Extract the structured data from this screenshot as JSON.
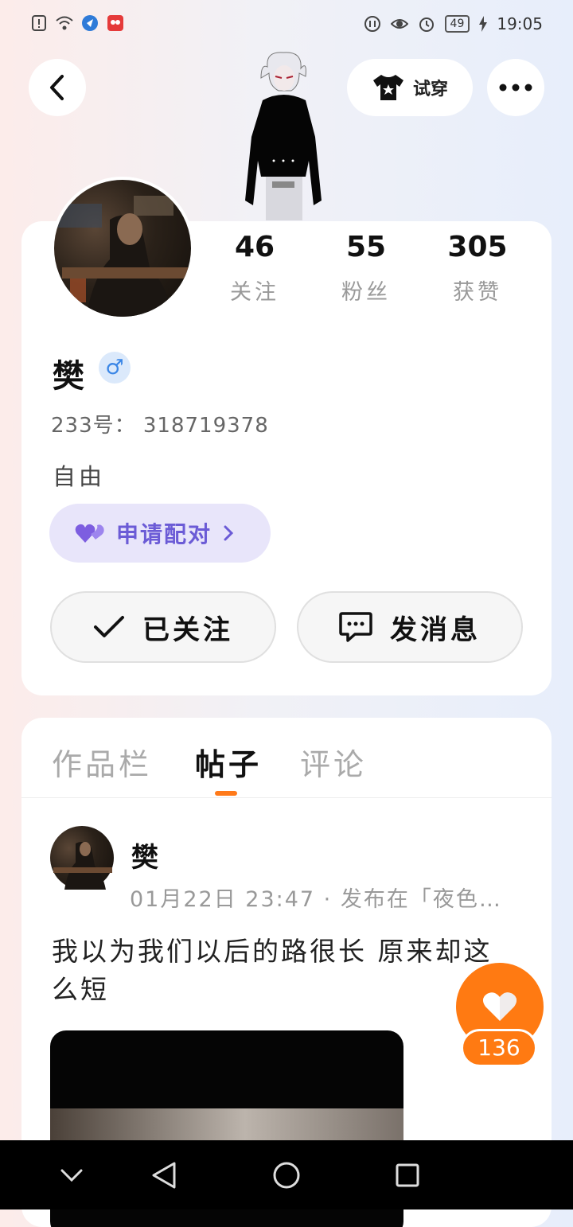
{
  "status_bar": {
    "time": "19:05",
    "battery": "49",
    "icons": [
      "alert-icon",
      "wifi-icon",
      "app-icon-blue",
      "app-icon-red",
      "nfc-icon",
      "eye-icon",
      "alarm-icon",
      "charging-icon"
    ]
  },
  "header": {
    "try_on_label": "试穿"
  },
  "profile": {
    "stats": [
      {
        "value": "46",
        "label": "关注"
      },
      {
        "value": "55",
        "label": "粉丝"
      },
      {
        "value": "305",
        "label": "获赞"
      }
    ],
    "name": "樊",
    "gender_symbol": "♂",
    "uid": "233号： 318719378",
    "bio": "自由",
    "pair_label": "申请配对",
    "follow_label": "已关注",
    "message_label": "发消息"
  },
  "tabs": [
    {
      "label": "作品栏",
      "active": false
    },
    {
      "label": "帖子",
      "active": true
    },
    {
      "label": "评论",
      "active": false
    }
  ],
  "post": {
    "author": "樊",
    "meta": "01月22日  23:47 · 发布在「夜色…",
    "text": "我以为我们以后的路很长 原来却这么短"
  },
  "like": {
    "count": "136"
  },
  "colors": {
    "accent_orange": "#ff7a12",
    "pair_purple": "#6b5bd6",
    "gender_blue": "#3a86e6"
  }
}
